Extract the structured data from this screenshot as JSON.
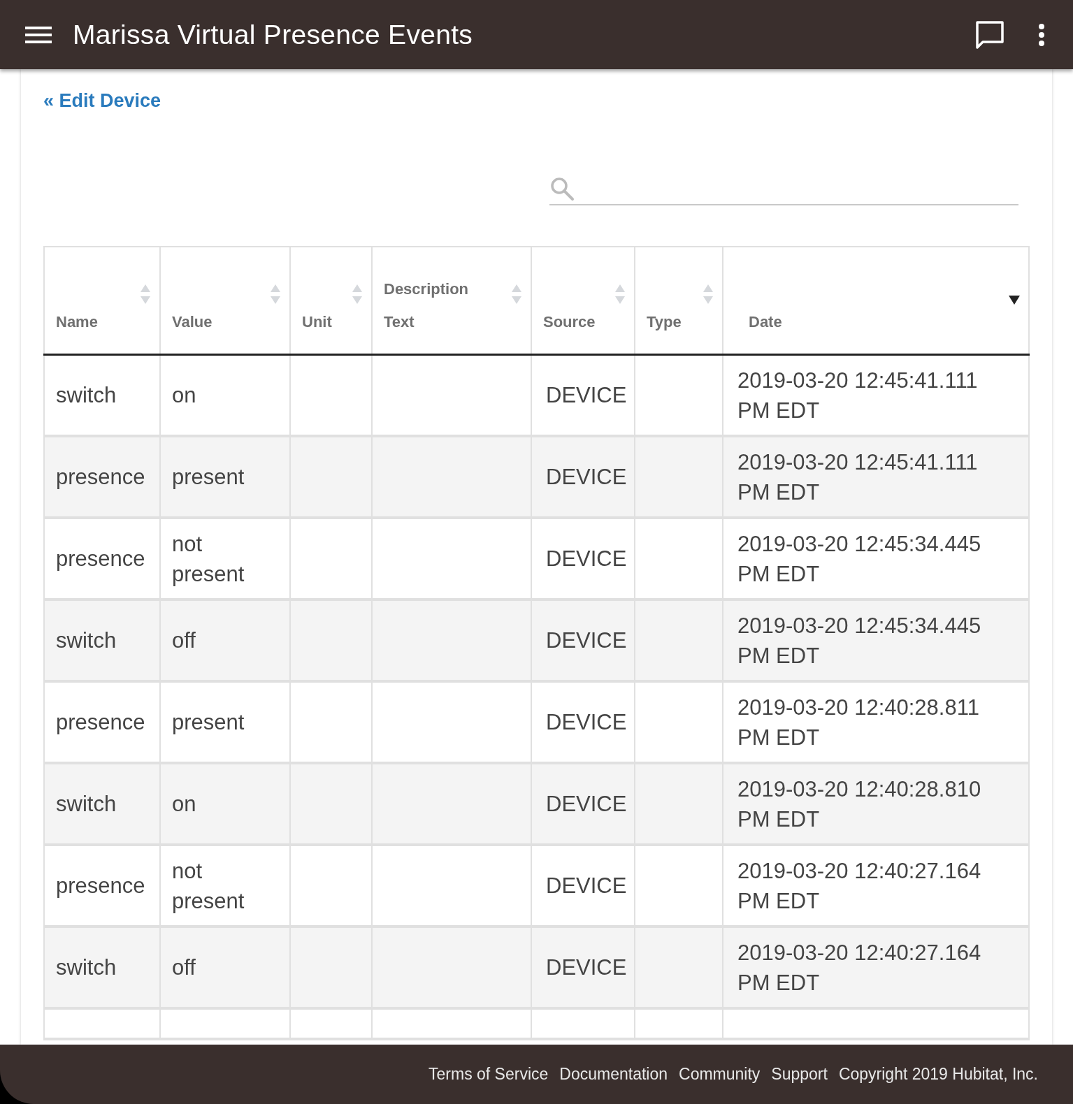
{
  "app_bar": {
    "title": "Marissa Virtual Presence Events"
  },
  "back_link": "« Edit Device",
  "table": {
    "columns": [
      {
        "label": "Name",
        "sorted": false
      },
      {
        "label": "Value",
        "sorted": false
      },
      {
        "label": "Unit",
        "sorted": false
      },
      {
        "label": "Description Text",
        "sorted": false
      },
      {
        "label": "Source",
        "sorted": false
      },
      {
        "label": "Type",
        "sorted": false
      },
      {
        "label": "Date",
        "sorted": true
      }
    ],
    "rows": [
      [
        "switch",
        "on",
        "",
        "",
        "DEVICE",
        "",
        "2019-03-20 12:45:41.111 PM EDT"
      ],
      [
        "presence",
        "present",
        "",
        "",
        "DEVICE",
        "",
        "2019-03-20 12:45:41.111 PM EDT"
      ],
      [
        "presence",
        "not present",
        "",
        "",
        "DEVICE",
        "",
        "2019-03-20 12:45:34.445 PM EDT"
      ],
      [
        "switch",
        "off",
        "",
        "",
        "DEVICE",
        "",
        "2019-03-20 12:45:34.445 PM EDT"
      ],
      [
        "presence",
        "present",
        "",
        "",
        "DEVICE",
        "",
        "2019-03-20 12:40:28.811 PM EDT"
      ],
      [
        "switch",
        "on",
        "",
        "",
        "DEVICE",
        "",
        "2019-03-20 12:40:28.810 PM EDT"
      ],
      [
        "presence",
        "not present",
        "",
        "",
        "DEVICE",
        "",
        "2019-03-20 12:40:27.164 PM EDT"
      ],
      [
        "switch",
        "off",
        "",
        "",
        "DEVICE",
        "",
        "2019-03-20 12:40:27.164 PM EDT"
      ]
    ]
  },
  "footer_links": [
    "Terms of Service",
    "Documentation",
    "Community",
    "Support",
    "Copyright 2019 Hubitat, Inc."
  ]
}
